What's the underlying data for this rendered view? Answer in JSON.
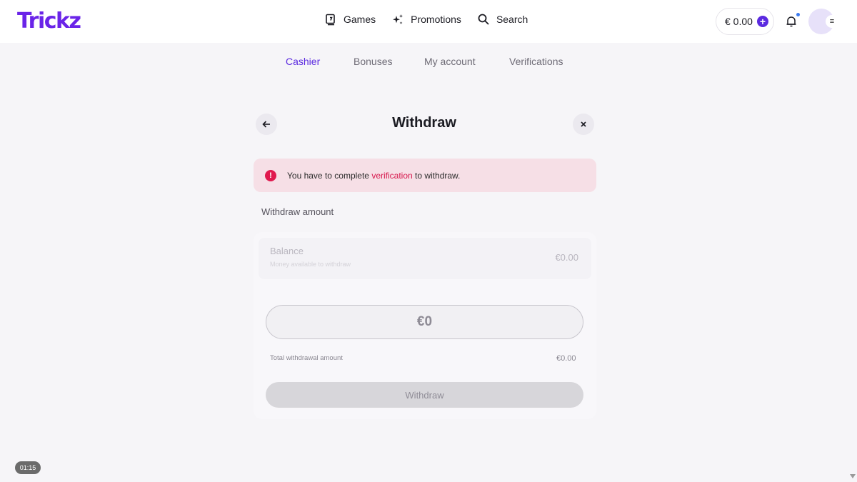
{
  "brand": {
    "logo_text": "Trickz",
    "accent": "#5b2ae0"
  },
  "header": {
    "nav": [
      {
        "label": "Games",
        "icon": "games-icon"
      },
      {
        "label": "Promotions",
        "icon": "sparkle-icon"
      },
      {
        "label": "Search",
        "icon": "search-icon"
      }
    ],
    "balance": "€ 0.00",
    "deposit_icon": "plus-icon",
    "notification_icon": "bell-icon",
    "menu_icon": "menu-icon"
  },
  "subtabs": [
    {
      "label": "Cashier",
      "active": true
    },
    {
      "label": "Bonuses",
      "active": false
    },
    {
      "label": "My account",
      "active": false
    },
    {
      "label": "Verifications",
      "active": false
    }
  ],
  "withdraw": {
    "title": "Withdraw",
    "alert": {
      "icon": "exclamation-icon",
      "text_before": "You have to complete ",
      "link": "verification",
      "text_after": " to withdraw."
    },
    "section_label": "Withdraw amount",
    "balance_label": "Balance",
    "balance_sub": "Money available to withdraw",
    "balance_value": "€0.00",
    "amount_placeholder": "€0",
    "total_label": "Total withdrawal amount",
    "total_value": "€0.00",
    "button_label": "Withdraw"
  },
  "timer": "01:15"
}
